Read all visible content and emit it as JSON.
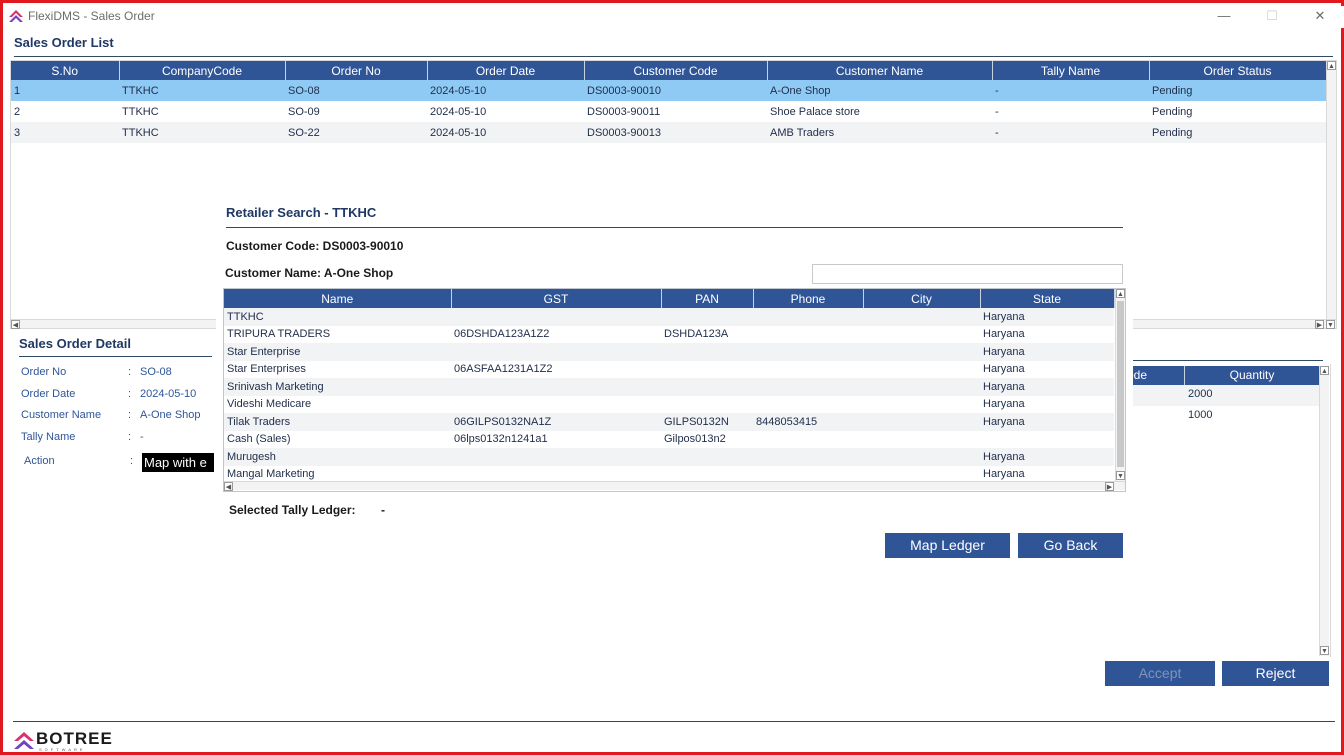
{
  "window": {
    "title": "FlexiDMS - Sales Order",
    "min": "—",
    "max": "☐",
    "close": "✕"
  },
  "order_list": {
    "title": "Sales Order List",
    "columns": [
      "S.No",
      "CompanyCode",
      "Order No",
      "Order Date",
      "Customer Code",
      "Customer Name",
      "Tally Name",
      "Order Status"
    ],
    "rows": [
      [
        "1",
        "TTKHC",
        "SO-08",
        "2024-05-10",
        "DS0003-90010",
        "A-One Shop",
        "-",
        "Pending"
      ],
      [
        "2",
        "TTKHC",
        "SO-09",
        "2024-05-10",
        "DS0003-90011",
        "Shoe Palace store",
        "-",
        "Pending"
      ],
      [
        "3",
        "TTKHC",
        "SO-22",
        "2024-05-10",
        "DS0003-90013",
        "AMB Traders",
        "-",
        "Pending"
      ]
    ]
  },
  "detail": {
    "title": "Sales Order Detail",
    "order_no_label": "Order No",
    "order_no": "SO-08",
    "order_date_label": "Order Date",
    "order_date": "2024-05-10",
    "customer_name_label": "Customer Name",
    "customer_name": "A-One Shop",
    "tally_name_label": "Tally Name",
    "tally_name": "-",
    "action_label": "Action",
    "action_value": "Map with e",
    "colon": ":"
  },
  "products": {
    "columns": [
      "ode",
      "Quantity"
    ],
    "rows": [
      [
        "",
        "2000"
      ],
      [
        "",
        "1000"
      ]
    ]
  },
  "retailer_search": {
    "title": "Retailer Search - TTKHC",
    "customer_code": "Customer Code: DS0003-90010",
    "customer_name": "Customer Name: A-One Shop",
    "search_value": "",
    "columns": [
      "Name",
      "GST",
      "PAN",
      "Phone",
      "City",
      "State"
    ],
    "rows": [
      [
        "TTKHC",
        "",
        "",
        "",
        "",
        "Haryana"
      ],
      [
        "TRIPURA TRADERS",
        "06DSHDA123A1Z2",
        "DSHDA123A",
        "",
        "",
        "Haryana"
      ],
      [
        "Star Enterprise",
        "",
        "",
        "",
        "",
        "Haryana"
      ],
      [
        "Star Enterprises",
        "06ASFAA1231A1Z2",
        "",
        "",
        "",
        "Haryana"
      ],
      [
        "Srinivash Marketing",
        "",
        "",
        "",
        "",
        "Haryana"
      ],
      [
        "Videshi Medicare",
        "",
        "",
        "",
        "",
        "Haryana"
      ],
      [
        "Tilak Traders",
        "06GILPS0132NA1Z",
        "GILPS0132N",
        "8448053415",
        "",
        "Haryana"
      ],
      [
        "Cash (Sales)",
        "06lps0132n1241a1",
        "Gilpos013n2",
        "",
        "",
        ""
      ],
      [
        "Murugesh",
        "",
        "",
        "",
        "",
        "Haryana"
      ],
      [
        "Mangal Marketing",
        "",
        "",
        "",
        "",
        "Haryana"
      ]
    ],
    "selected_label": "Selected Tally Ledger:",
    "selected_value": "-",
    "map_button": "Map Ledger",
    "back_button": "Go Back"
  },
  "actions": {
    "accept": "Accept",
    "reject": "Reject"
  },
  "brand": {
    "name": "BOTREE",
    "tagline": "SOFTWARE"
  },
  "colors": {
    "header": "#2f5597",
    "selected_row": "#8fcaf5",
    "border": "#e0191f"
  }
}
